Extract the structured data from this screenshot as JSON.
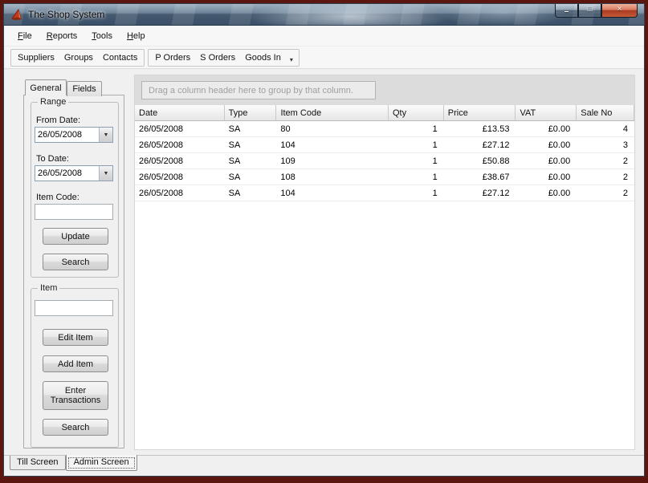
{
  "window": {
    "title": "The Shop System"
  },
  "icons": {
    "minimize": "–",
    "maximize": "□",
    "close": "×",
    "dropdown": "▼",
    "overflow": "▾"
  },
  "menu": {
    "items": [
      "File",
      "Reports",
      "Tools",
      "Help"
    ]
  },
  "toolbar": {
    "group1": [
      "Suppliers",
      "Groups",
      "Contacts"
    ],
    "group2": [
      "P Orders",
      "S Orders",
      "Goods In"
    ]
  },
  "sidebar": {
    "tabs": [
      "General",
      "Fields"
    ],
    "range": {
      "title": "Range",
      "from_label": "From Date:",
      "from_value": "26/05/2008",
      "to_label": "To Date:",
      "to_value": "26/05/2008",
      "item_code_label": "Item Code:",
      "item_code_value": "",
      "update_button": "Update",
      "search_button": "Search"
    },
    "item": {
      "title": "Item",
      "item_value": "",
      "edit_button": "Edit Item",
      "add_button": "Add Item",
      "enter_transactions_button": "Enter Transactions",
      "search_button": "Search"
    }
  },
  "grid": {
    "group_hint": "Drag a column header here to group by that column.",
    "columns": [
      "Date",
      "Type",
      "Item Code",
      "Qty",
      "Price",
      "VAT",
      "Sale No"
    ],
    "rows": [
      [
        "26/05/2008",
        "SA",
        "80",
        "1",
        "£13.53",
        "£0.00",
        "4"
      ],
      [
        "26/05/2008",
        "SA",
        "104",
        "1",
        "£27.12",
        "£0.00",
        "3"
      ],
      [
        "26/05/2008",
        "SA",
        "109",
        "1",
        "£50.88",
        "£0.00",
        "2"
      ],
      [
        "26/05/2008",
        "SA",
        "108",
        "1",
        "£38.67",
        "£0.00",
        "2"
      ],
      [
        "26/05/2008",
        "SA",
        "104",
        "1",
        "£27.12",
        "£0.00",
        "2"
      ]
    ]
  },
  "bottom_tabs": [
    "Till Screen",
    "Admin Screen"
  ]
}
